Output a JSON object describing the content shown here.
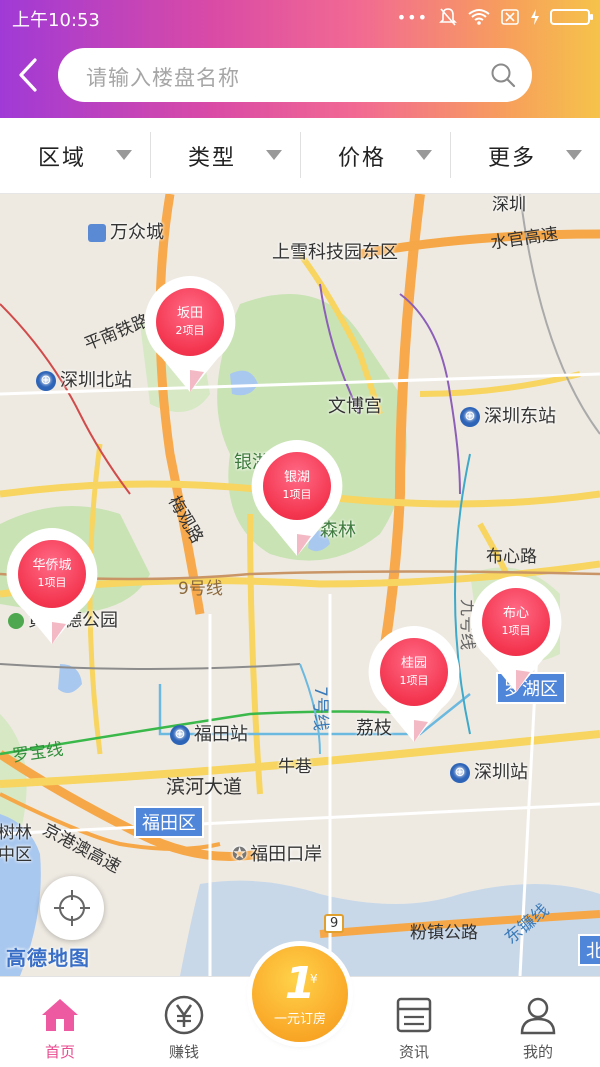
{
  "status_bar": {
    "time": "上午10:53"
  },
  "search": {
    "placeholder": "请输入楼盘名称"
  },
  "filters": [
    {
      "label": "区域"
    },
    {
      "label": "类型"
    },
    {
      "label": "价格"
    },
    {
      "label": "更多"
    }
  ],
  "map": {
    "labels": {
      "wanzhongcheng": "万众城",
      "shangxue": "上雪科技园东区",
      "shuiguan": "水官高速",
      "shenzhen_top": "深圳",
      "pingnan": "平南铁路",
      "shenzhen_north": "深圳北站",
      "wenbo": "文博宫",
      "shenzhen_east": "深圳东站",
      "yinhu_park": "银湖公园",
      "meiguan": "梅观路",
      "senlin": "森林",
      "buxin_road": "布心路",
      "line9": "9号线",
      "huanghuai": "黄怀德公园",
      "line9b": "九号线",
      "line7": "7号线",
      "futian_station": "福田站",
      "lizhi": "荔枝",
      "luobao": "罗宝线",
      "niuxiang": "牛巷",
      "shenzhen_station": "深圳站",
      "binhe": "滨河大道",
      "futian_district": "福田区",
      "luohu_district": "罗湖区",
      "jinggang": "京港澳高速",
      "futian_port": "福田口岸",
      "fenshui": "粉镇公路",
      "dongcheng": "东镰线",
      "route9": "9",
      "north": "北",
      "linlin": "树林",
      "zhongqu": "中区"
    },
    "logo": "高德地图",
    "pins": [
      {
        "name": "坂田",
        "count": "2项目"
      },
      {
        "name": "银湖",
        "count": "1项目"
      },
      {
        "name": "华侨城",
        "count": "1项目"
      },
      {
        "name": "布心",
        "count": "1项目"
      },
      {
        "name": "桂园",
        "count": "1项目"
      }
    ]
  },
  "nav": {
    "home": "首页",
    "earn": "赚钱",
    "center_big": "1",
    "center_yen": "¥",
    "center_small": "一元订房",
    "news": "资讯",
    "mine": "我的"
  },
  "colors": {
    "brand_pink": "#e94b8f",
    "pin_red": "#f4354f",
    "center_orange": "#fbb02e"
  }
}
